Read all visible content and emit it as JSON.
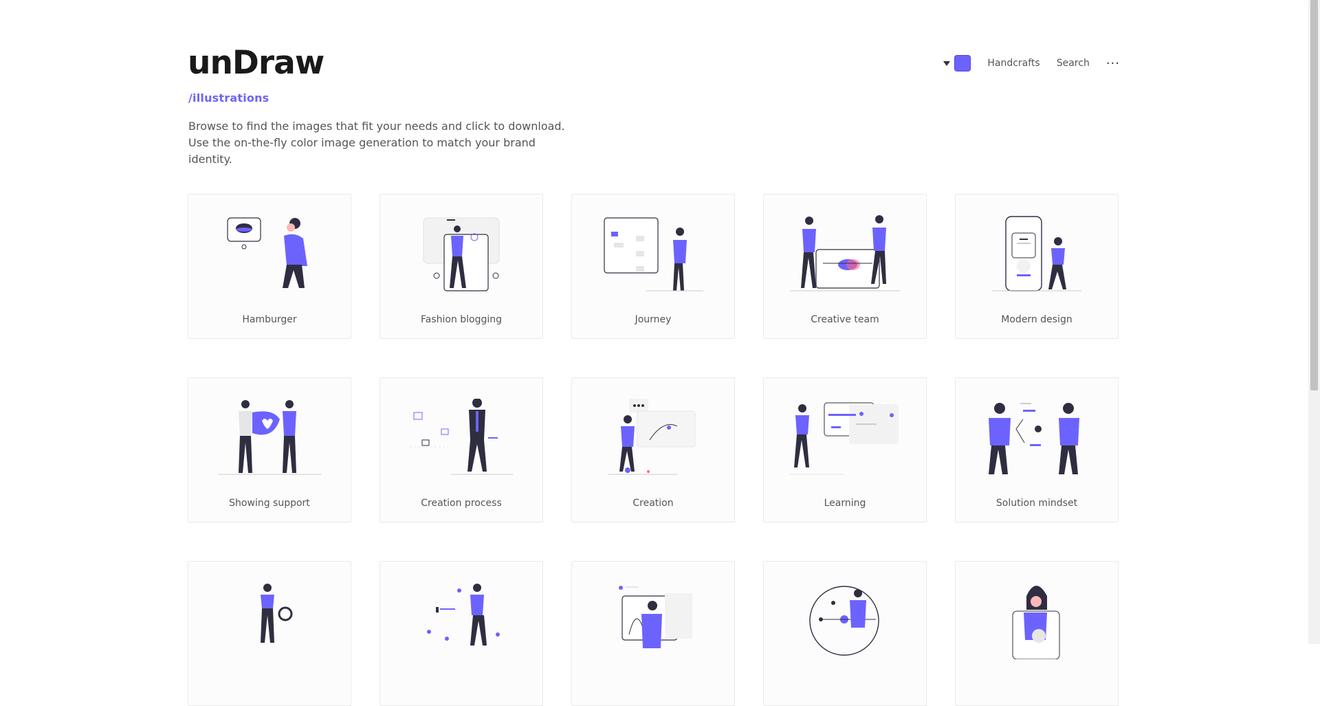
{
  "header": {
    "logo": "unDraw",
    "subtitle": "/illustrations",
    "intro": "Browse to find the images that fit your needs and click to download. Use the on-the-fly color image generation to match your brand identity."
  },
  "nav": {
    "handcrafts": "Handcrafts",
    "search": "Search",
    "more": "···"
  },
  "colors": {
    "accent": "#6c63ff",
    "dark": "#2f2e41",
    "light": "#e6e6e6"
  },
  "cards": [
    {
      "label": "Hamburger"
    },
    {
      "label": "Fashion blogging"
    },
    {
      "label": "Journey"
    },
    {
      "label": "Creative team"
    },
    {
      "label": "Modern design"
    },
    {
      "label": "Showing support"
    },
    {
      "label": "Creation process"
    },
    {
      "label": "Creation"
    },
    {
      "label": "Learning"
    },
    {
      "label": "Solution mindset"
    },
    {
      "label": ""
    },
    {
      "label": ""
    },
    {
      "label": ""
    },
    {
      "label": ""
    },
    {
      "label": ""
    }
  ]
}
